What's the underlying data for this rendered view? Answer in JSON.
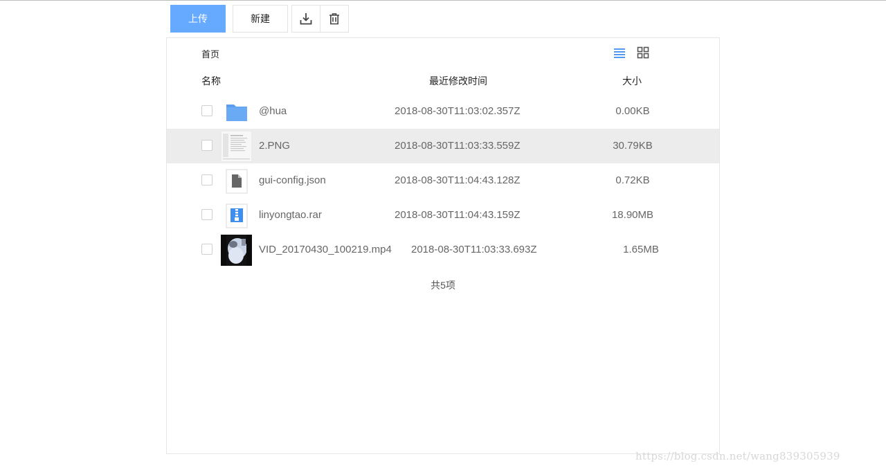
{
  "toolbar": {
    "upload_label": "上传",
    "new_label": "新建",
    "download_icon": "download-icon",
    "delete_icon": "trash-icon",
    "accent_color": "#66aaff"
  },
  "breadcrumb": {
    "home": "首页"
  },
  "view": {
    "list_icon": "list-view-icon",
    "grid_icon": "grid-view-icon",
    "active": "list"
  },
  "columns": {
    "name": "名称",
    "modified": "最近修改时间",
    "size": "大小"
  },
  "files": [
    {
      "name": "@hua",
      "modified": "2018-08-30T11:03:02.357Z",
      "size": "0.00KB",
      "type": "folder"
    },
    {
      "name": "2.PNG",
      "modified": "2018-08-30T11:03:33.559Z",
      "size": "30.79KB",
      "type": "image"
    },
    {
      "name": "gui-config.json",
      "modified": "2018-08-30T11:04:43.128Z",
      "size": "0.72KB",
      "type": "file"
    },
    {
      "name": "linyongtao.rar",
      "modified": "2018-08-30T11:04:43.159Z",
      "size": "18.90MB",
      "type": "archive"
    },
    {
      "name": "VID_20170430_100219.mp4",
      "modified": "2018-08-30T11:03:33.693Z",
      "size": "1.65MB",
      "type": "video"
    }
  ],
  "summary": "共5项",
  "watermark": "https://blog.csdn.net/wang839305939"
}
